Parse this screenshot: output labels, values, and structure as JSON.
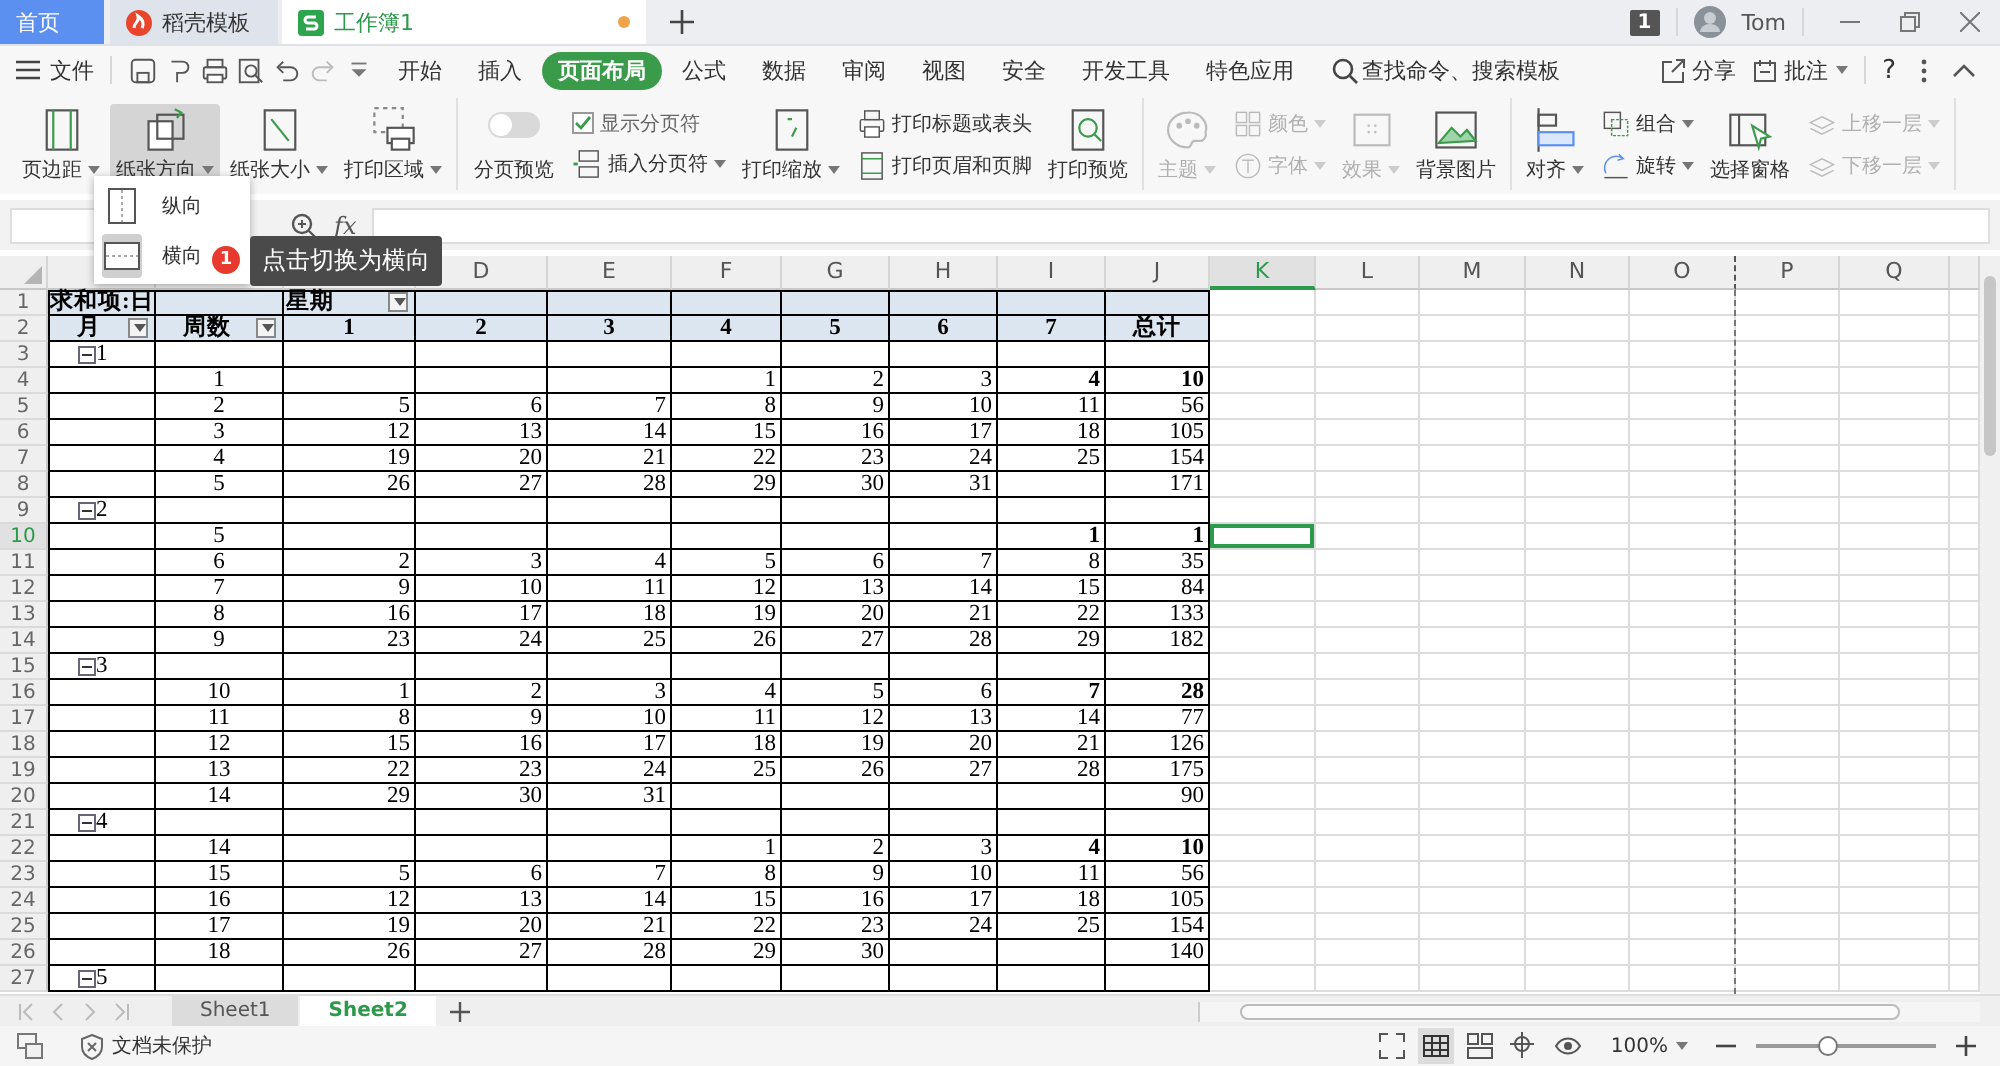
{
  "title_tabs": [
    {
      "label": "首页",
      "kind": "home",
      "selected": false,
      "modified": false
    },
    {
      "label": "稻壳模板",
      "kind": "docer",
      "selected": false,
      "modified": false
    },
    {
      "label": "工作簿1",
      "kind": "sheet",
      "selected": true,
      "modified": true
    }
  ],
  "account": {
    "badge": "1",
    "user": "Tom"
  },
  "menu": {
    "file": "文件",
    "tabs": [
      {
        "label": "开始",
        "selected": false
      },
      {
        "label": "插入",
        "selected": false
      },
      {
        "label": "页面布局",
        "selected": true
      },
      {
        "label": "公式",
        "selected": false
      },
      {
        "label": "数据",
        "selected": false
      },
      {
        "label": "审阅",
        "selected": false
      },
      {
        "label": "视图",
        "selected": false
      },
      {
        "label": "安全",
        "selected": false
      },
      {
        "label": "开发工具",
        "selected": false
      },
      {
        "label": "特色应用",
        "selected": false
      }
    ],
    "search": "查找命令、搜索模板",
    "share": "分享",
    "comment": "批注",
    "help": "?"
  },
  "ribbon": [
    {
      "items": [
        {
          "kind": "large",
          "label": "页边距",
          "dropdown": true,
          "pressed": false,
          "disabled": false
        },
        {
          "kind": "large",
          "label": "纸张方向",
          "dropdown": true,
          "pressed": true,
          "disabled": false
        },
        {
          "kind": "large",
          "label": "纸张大小",
          "dropdown": true,
          "pressed": false,
          "disabled": false
        },
        {
          "kind": "large",
          "label": "打印区域",
          "dropdown": true,
          "pressed": false,
          "disabled": false
        }
      ]
    },
    {
      "items": [
        {
          "kind": "toggle",
          "label": "分页预览",
          "on": false
        },
        {
          "kind": "stack",
          "items": [
            {
              "kind": "check",
              "label": "显示分页符",
              "checked": true
            },
            {
              "kind": "small",
              "label": "插入分页符",
              "dropdown": true,
              "disabled": false
            }
          ]
        },
        {
          "kind": "large",
          "label": "打印缩放",
          "dropdown": true,
          "pressed": false,
          "disabled": false
        },
        {
          "kind": "stack",
          "items": [
            {
              "kind": "small",
              "label": "打印标题或表头",
              "dropdown": false,
              "disabled": false
            },
            {
              "kind": "small",
              "label": "打印页眉和页脚",
              "dropdown": false,
              "disabled": false
            }
          ]
        },
        {
          "kind": "large",
          "label": "打印预览",
          "dropdown": false,
          "pressed": false,
          "disabled": false
        }
      ]
    },
    {
      "items": [
        {
          "kind": "large",
          "label": "主题",
          "dropdown": true,
          "pressed": false,
          "disabled": true
        },
        {
          "kind": "stack",
          "items": [
            {
              "kind": "small",
              "label": "颜色",
              "dropdown": true,
              "disabled": true
            },
            {
              "kind": "small",
              "label": "字体",
              "dropdown": true,
              "disabled": true
            }
          ]
        },
        {
          "kind": "large",
          "label": "效果",
          "dropdown": true,
          "pressed": false,
          "disabled": true
        },
        {
          "kind": "large",
          "label": "背景图片",
          "dropdown": false,
          "pressed": false,
          "disabled": false
        }
      ]
    },
    {
      "items": [
        {
          "kind": "large",
          "label": "对齐",
          "dropdown": true,
          "pressed": false,
          "disabled": false
        },
        {
          "kind": "stack",
          "items": [
            {
              "kind": "small",
              "label": "组合",
              "dropdown": true,
              "disabled": false
            },
            {
              "kind": "small",
              "label": "旋转",
              "dropdown": true,
              "disabled": false
            }
          ]
        },
        {
          "kind": "large",
          "label": "选择窗格",
          "dropdown": false,
          "pressed": false,
          "disabled": false
        },
        {
          "kind": "stack",
          "items": [
            {
              "kind": "small",
              "label": "上移一层",
              "dropdown": true,
              "disabled": true
            },
            {
              "kind": "small",
              "label": "下移一层",
              "dropdown": true,
              "disabled": true
            }
          ]
        }
      ]
    }
  ],
  "orientation_menu": {
    "items": [
      {
        "label": "纵向",
        "selected": false
      },
      {
        "label": "横向",
        "selected": true
      }
    ]
  },
  "tooltip": {
    "step": "1",
    "text": "点击切换为横向"
  },
  "formula_bar": {
    "function_label": "fx"
  },
  "sheet": {
    "columns": [
      {
        "selected": false,
        "page_break": false
      },
      {
        "selected": false,
        "page_break": false
      },
      {
        "selected": false,
        "page_break": false
      },
      {
        "label": "D",
        "selected": false,
        "page_break": false
      },
      {
        "label": "E",
        "selected": false,
        "page_break": false
      },
      {
        "label": "F",
        "selected": false,
        "page_break": false
      },
      {
        "label": "G",
        "selected": false,
        "page_break": false
      },
      {
        "label": "H",
        "selected": false,
        "page_break": false
      },
      {
        "label": "I",
        "selected": false,
        "page_break": false
      },
      {
        "label": "J",
        "selected": false,
        "page_break": false
      },
      {
        "label": "K",
        "selected": true,
        "page_break": false
      },
      {
        "label": "L",
        "selected": false,
        "page_break": false
      },
      {
        "label": "M",
        "selected": false,
        "page_break": false
      },
      {
        "label": "N",
        "selected": false,
        "page_break": false
      },
      {
        "label": "O",
        "selected": false,
        "page_break": true
      },
      {
        "label": "P",
        "selected": false,
        "page_break": false
      },
      {
        "label": "Q",
        "selected": false,
        "page_break": false
      }
    ],
    "rows": [
      {
        "number": "1",
        "kind": "title",
        "selected": false,
        "cells": {
          "a": {
            "text": "求和项:日",
            "filter": false
          },
          "c": {
            "text": "星期",
            "filter": true
          }
        }
      },
      {
        "number": "2",
        "kind": "header",
        "selected": false,
        "cells": {
          "a": {
            "text": "月",
            "filter": true
          },
          "b": {
            "text": "周数",
            "filter": true
          },
          "c": {
            "text": "1",
            "filter": false
          },
          "d": {
            "text": "2",
            "filter": false
          },
          "e": {
            "text": "3",
            "filter": false
          },
          "f": {
            "text": "4",
            "filter": false
          },
          "g": {
            "text": "5",
            "filter": false
          },
          "h": {
            "text": "6",
            "filter": false
          },
          "i": {
            "text": "7",
            "filter": false
          },
          "j": {
            "text": "总计",
            "filter": false
          }
        }
      },
      {
        "number": "3",
        "kind": "group",
        "selected": false,
        "label": "1",
        "expanded": true
      },
      {
        "number": "4",
        "kind": "data",
        "selected": false,
        "cells": {
          "b": "1",
          "f": "1",
          "g": "2",
          "h": "3",
          "i": "4",
          "j": "10"
        },
        "bold_last": true
      },
      {
        "number": "5",
        "kind": "data",
        "selected": false,
        "cells": {
          "b": "2",
          "c": "5",
          "d": "6",
          "e": "7",
          "f": "8",
          "g": "9",
          "h": "10",
          "i": "11",
          "j": "56"
        },
        "bold_last": false
      },
      {
        "number": "6",
        "kind": "data",
        "selected": false,
        "cells": {
          "b": "3",
          "c": "12",
          "d": "13",
          "e": "14",
          "f": "15",
          "g": "16",
          "h": "17",
          "i": "18",
          "j": "105"
        },
        "bold_last": false
      },
      {
        "number": "7",
        "kind": "data",
        "selected": false,
        "cells": {
          "b": "4",
          "c": "19",
          "d": "20",
          "e": "21",
          "f": "22",
          "g": "23",
          "h": "24",
          "i": "25",
          "j": "154"
        },
        "bold_last": false
      },
      {
        "number": "8",
        "kind": "data",
        "selected": false,
        "cells": {
          "b": "5",
          "c": "26",
          "d": "27",
          "e": "28",
          "f": "29",
          "g": "30",
          "h": "31",
          "j": "171"
        },
        "bold_last": false
      },
      {
        "number": "9",
        "kind": "group",
        "selected": false,
        "label": "2",
        "expanded": true
      },
      {
        "number": "10",
        "kind": "data",
        "selected": true,
        "cells": {
          "b": "5",
          "i": "1",
          "j": "1"
        },
        "bold_last": true
      },
      {
        "number": "11",
        "kind": "data",
        "selected": false,
        "cells": {
          "b": "6",
          "c": "2",
          "d": "3",
          "e": "4",
          "f": "5",
          "g": "6",
          "h": "7",
          "i": "8",
          "j": "35"
        },
        "bold_last": false
      },
      {
        "number": "12",
        "kind": "data",
        "selected": false,
        "cells": {
          "b": "7",
          "c": "9",
          "d": "10",
          "e": "11",
          "f": "12",
          "g": "13",
          "h": "14",
          "i": "15",
          "j": "84"
        },
        "bold_last": false
      },
      {
        "number": "13",
        "kind": "data",
        "selected": false,
        "cells": {
          "b": "8",
          "c": "16",
          "d": "17",
          "e": "18",
          "f": "19",
          "g": "20",
          "h": "21",
          "i": "22",
          "j": "133"
        },
        "bold_last": false
      },
      {
        "number": "14",
        "kind": "data",
        "selected": false,
        "cells": {
          "b": "9",
          "c": "23",
          "d": "24",
          "e": "25",
          "f": "26",
          "g": "27",
          "h": "28",
          "i": "29",
          "j": "182"
        },
        "bold_last": false
      },
      {
        "number": "15",
        "kind": "group",
        "selected": false,
        "label": "3",
        "expanded": true
      },
      {
        "number": "16",
        "kind": "data",
        "selected": false,
        "cells": {
          "b": "10",
          "c": "1",
          "d": "2",
          "e": "3",
          "f": "4",
          "g": "5",
          "h": "6",
          "i": "7",
          "j": "28"
        },
        "bold_last": true
      },
      {
        "number": "17",
        "kind": "data",
        "selected": false,
        "cells": {
          "b": "11",
          "c": "8",
          "d": "9",
          "e": "10",
          "f": "11",
          "g": "12",
          "h": "13",
          "i": "14",
          "j": "77"
        },
        "bold_last": false
      },
      {
        "number": "18",
        "kind": "data",
        "selected": false,
        "cells": {
          "b": "12",
          "c": "15",
          "d": "16",
          "e": "17",
          "f": "18",
          "g": "19",
          "h": "20",
          "i": "21",
          "j": "126"
        },
        "bold_last": false
      },
      {
        "number": "19",
        "kind": "data",
        "selected": false,
        "cells": {
          "b": "13",
          "c": "22",
          "d": "23",
          "e": "24",
          "f": "25",
          "g": "26",
          "h": "27",
          "i": "28",
          "j": "175"
        },
        "bold_last": false
      },
      {
        "number": "20",
        "kind": "data",
        "selected": false,
        "cells": {
          "b": "14",
          "c": "29",
          "d": "30",
          "e": "31",
          "j": "90"
        },
        "bold_last": false
      },
      {
        "number": "21",
        "kind": "group",
        "selected": false,
        "label": "4",
        "expanded": true
      },
      {
        "number": "22",
        "kind": "data",
        "selected": false,
        "cells": {
          "b": "14",
          "f": "1",
          "g": "2",
          "h": "3",
          "i": "4",
          "j": "10"
        },
        "bold_last": true
      },
      {
        "number": "23",
        "kind": "data",
        "selected": false,
        "cells": {
          "b": "15",
          "c": "5",
          "d": "6",
          "e": "7",
          "f": "8",
          "g": "9",
          "h": "10",
          "i": "11",
          "j": "56"
        },
        "bold_last": false
      },
      {
        "number": "24",
        "kind": "data",
        "selected": false,
        "cells": {
          "b": "16",
          "c": "12",
          "d": "13",
          "e": "14",
          "f": "15",
          "g": "16",
          "h": "17",
          "i": "18",
          "j": "105"
        },
        "bold_last": false
      },
      {
        "number": "25",
        "kind": "data",
        "selected": false,
        "cells": {
          "b": "17",
          "c": "19",
          "d": "20",
          "e": "21",
          "f": "22",
          "g": "23",
          "h": "24",
          "i": "25",
          "j": "154"
        },
        "bold_last": false
      },
      {
        "number": "26",
        "kind": "data",
        "selected": false,
        "cells": {
          "b": "18",
          "c": "26",
          "d": "27",
          "e": "28",
          "f": "29",
          "g": "30",
          "j": "140"
        },
        "bold_last": false
      },
      {
        "number": "27",
        "kind": "group",
        "selected": false,
        "label": "5",
        "expanded": true
      }
    ]
  },
  "sheet_tabs": [
    {
      "label": "Sheet1",
      "selected": false
    },
    {
      "label": "Sheet2",
      "selected": true
    }
  ],
  "status_bar": {
    "protection": "文档未保护",
    "zoom": "100%",
    "zoom_slider": {
      "level": 0.4
    }
  }
}
